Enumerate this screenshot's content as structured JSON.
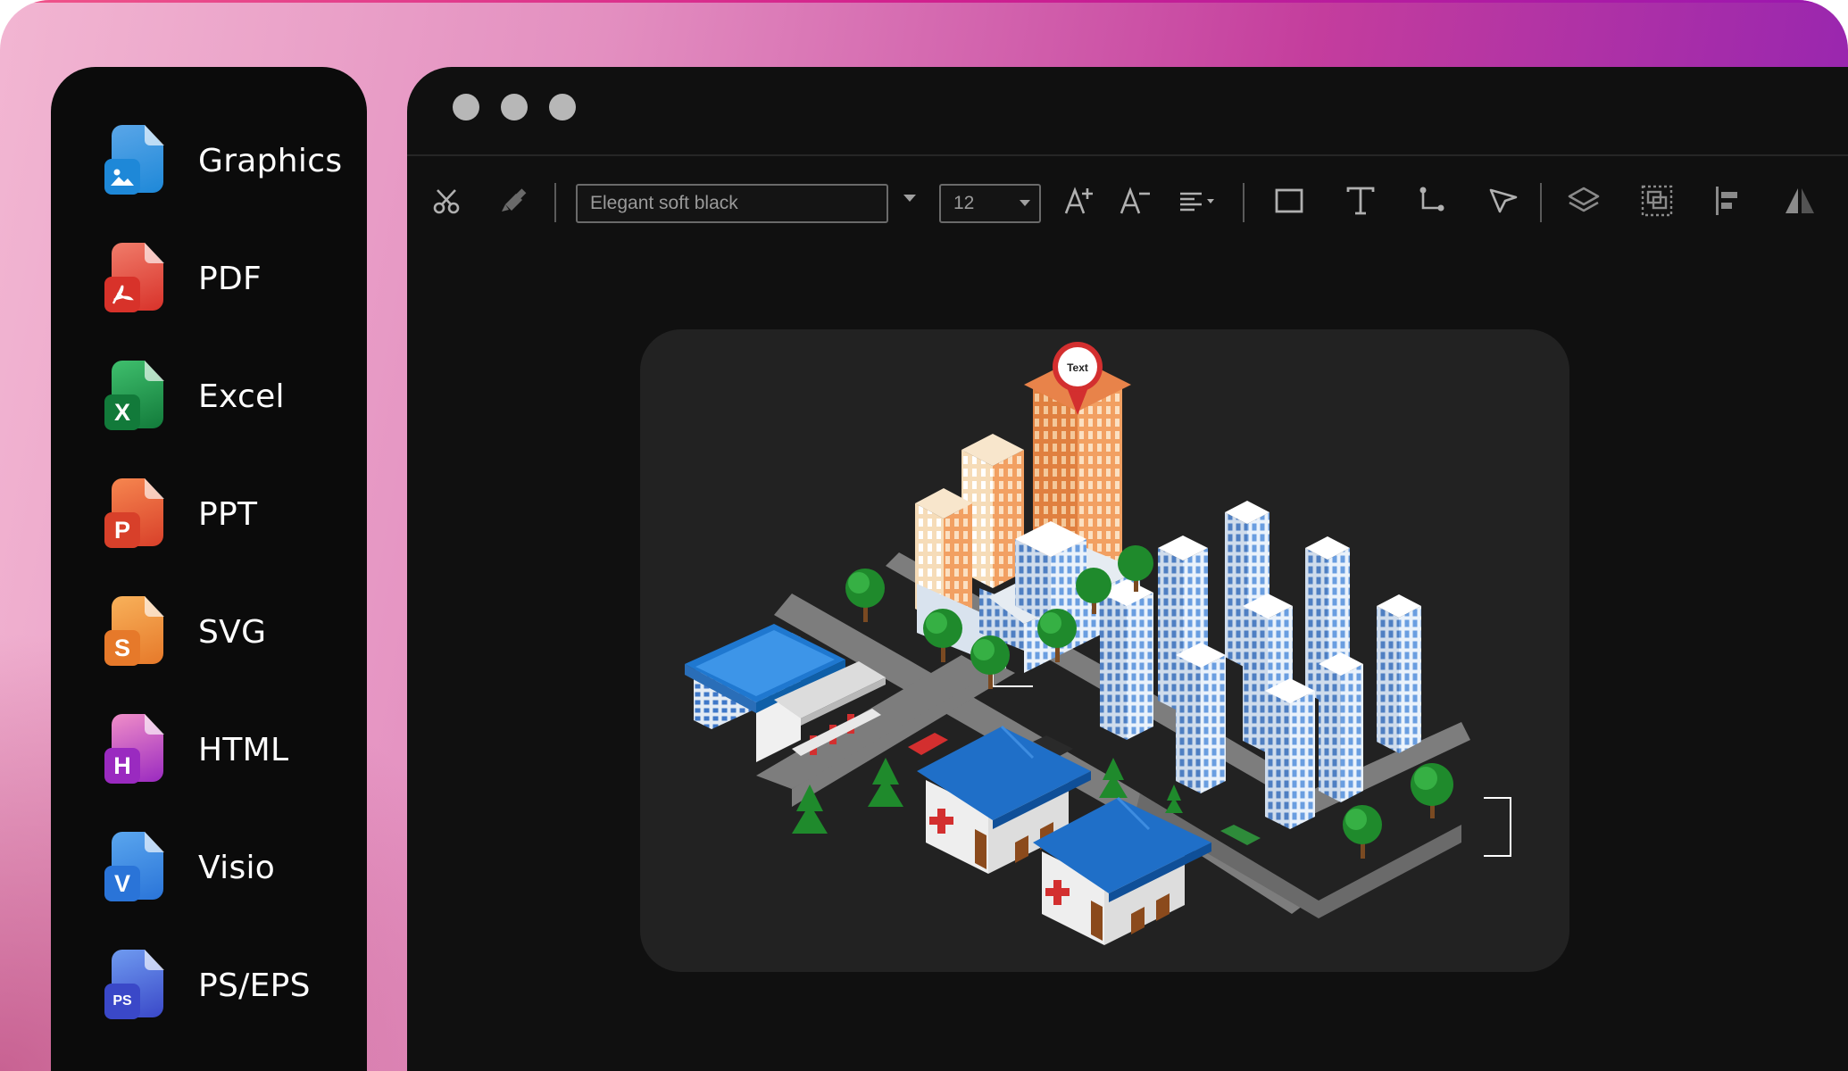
{
  "sidebar": {
    "items": [
      {
        "label": "Graphics",
        "icon": "image-file-icon",
        "badge": "",
        "color": "#5aa6e8",
        "badge_color": "#1e88d8"
      },
      {
        "label": "PDF",
        "icon": "pdf-file-icon",
        "badge": "",
        "color": "#f07c6a",
        "badge_color": "#d8322a"
      },
      {
        "label": "Excel",
        "icon": "excel-file-icon",
        "badge": "X",
        "color": "#3fbf6d",
        "badge_color": "#127a3a"
      },
      {
        "label": "PPT",
        "icon": "ppt-file-icon",
        "badge": "P",
        "color": "#f6864f",
        "badge_color": "#d8402a"
      },
      {
        "label": "SVG",
        "icon": "svg-file-icon",
        "badge": "S",
        "color": "#f8b15a",
        "badge_color": "#e6792a"
      },
      {
        "label": "HTML",
        "icon": "html-file-icon",
        "badge": "H",
        "color": "#f08ec8",
        "badge_color": "#9a2ac0"
      },
      {
        "label": "Visio",
        "icon": "visio-file-icon",
        "badge": "V",
        "color": "#5aa6ee",
        "badge_color": "#2a74d8"
      },
      {
        "label": "PS/EPS",
        "icon": "ps-eps-file-icon",
        "badge": "PS",
        "color": "#6f9bf0",
        "badge_color": "#3a48c8"
      }
    ]
  },
  "window": {
    "controls": [
      "window-dot-1",
      "window-dot-2",
      "window-dot-3"
    ]
  },
  "toolbar": {
    "font_value": "Elegant soft black",
    "font_size": "12",
    "tools": [
      "cut-icon",
      "format-painter-icon",
      "increase-font-icon",
      "decrease-font-icon",
      "align-icon",
      "rectangle-icon",
      "text-icon",
      "connector-icon",
      "pointer-icon",
      "layers-icon",
      "group-icon",
      "align-left-icon",
      "flip-icon"
    ]
  },
  "canvas": {
    "pin_label": "Text"
  }
}
